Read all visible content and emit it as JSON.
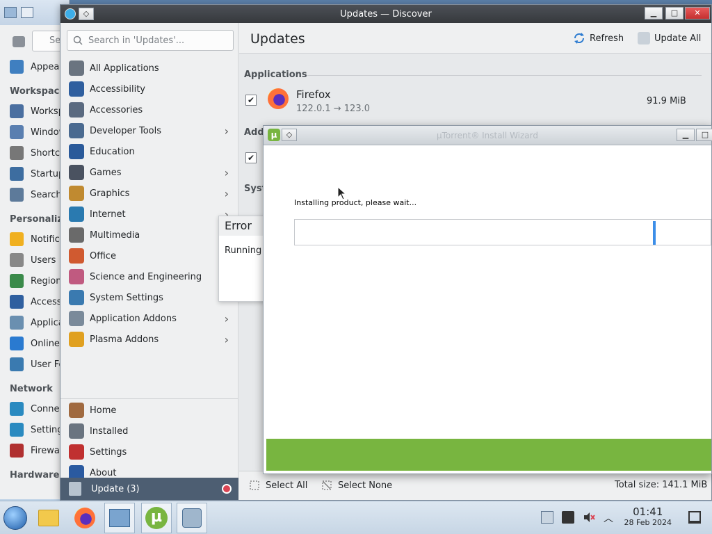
{
  "bg_window": {
    "search_placeholder": "Se",
    "items": [
      {
        "label": "Appea",
        "icon": "appearance-icon",
        "color": "#3f7fc0"
      },
      {
        "label": "Worksp",
        "icon": "workspace-icon",
        "color": "#4a6fa0"
      },
      {
        "label": "Window",
        "icon": "window-icon",
        "color": "#5a7fb0"
      },
      {
        "label": "Shortc",
        "icon": "keyboard-icon",
        "color": "#777777"
      },
      {
        "label": "Startup",
        "icon": "startup-icon",
        "color": "#3d6da0"
      },
      {
        "label": "Search",
        "icon": "search-icon",
        "color": "#5d7a9a"
      },
      {
        "label": "Notifica",
        "icon": "bell-icon",
        "color": "#f0b020"
      },
      {
        "label": "Users",
        "icon": "users-icon",
        "color": "#888888"
      },
      {
        "label": "Regiona",
        "icon": "globe-icon",
        "color": "#3a8a4a"
      },
      {
        "label": "Accessi",
        "icon": "accessibility-icon",
        "color": "#2f5f9f"
      },
      {
        "label": "Applica",
        "icon": "applications-icon",
        "color": "#6a8fb0"
      },
      {
        "label": "Online A",
        "icon": "online-accounts-icon",
        "color": "#2a7ad0"
      },
      {
        "label": "User Fe",
        "icon": "feedback-icon",
        "color": "#3a7ab0"
      },
      {
        "label": "Conne",
        "icon": "network-icon",
        "color": "#2a8ac0"
      },
      {
        "label": "Settings",
        "icon": "network-settings-icon",
        "color": "#2a8ac0"
      },
      {
        "label": "Firewal",
        "icon": "firewall-icon",
        "color": "#b03030"
      }
    ],
    "headings": [
      "Workspace",
      "Personaliza",
      "Network",
      "Hardware"
    ]
  },
  "discover": {
    "title": "Updates — Discover",
    "search_placeholder": "Search in 'Updates'...",
    "categories": [
      {
        "label": "All Applications",
        "icon": "grid-icon",
        "color": "#6a7480",
        "submenu": false
      },
      {
        "label": "Accessibility",
        "icon": "accessibility-icon",
        "color": "#2f5f9f",
        "submenu": false
      },
      {
        "label": "Accessories",
        "icon": "accessories-icon",
        "color": "#5a6a80",
        "submenu": false
      },
      {
        "label": "Developer Tools",
        "icon": "developer-tools-icon",
        "color": "#4a6a90",
        "submenu": true
      },
      {
        "label": "Education",
        "icon": "education-icon",
        "color": "#2a5a9a",
        "submenu": false
      },
      {
        "label": "Games",
        "icon": "games-icon",
        "color": "#4a5260",
        "submenu": true
      },
      {
        "label": "Graphics",
        "icon": "graphics-icon",
        "color": "#c08a30",
        "submenu": true
      },
      {
        "label": "Internet",
        "icon": "internet-icon",
        "color": "#2a7ab0",
        "submenu": true
      },
      {
        "label": "Multimedia",
        "icon": "multimedia-icon",
        "color": "#6a6a6a",
        "submenu": false
      },
      {
        "label": "Office",
        "icon": "office-icon",
        "color": "#d05a30",
        "submenu": false
      },
      {
        "label": "Science and Engineering",
        "icon": "science-icon",
        "color": "#c05a80",
        "submenu": false
      },
      {
        "label": "System Settings",
        "icon": "system-settings-icon",
        "color": "#3a7ab0",
        "submenu": false
      },
      {
        "label": "Application Addons",
        "icon": "application-addons-icon",
        "color": "#7a8a9a",
        "submenu": true
      },
      {
        "label": "Plasma Addons",
        "icon": "plasma-addons-icon",
        "color": "#e0a020",
        "submenu": true
      }
    ],
    "nav": [
      {
        "label": "Home",
        "icon": "home-icon",
        "color": "#a06a40"
      },
      {
        "label": "Installed",
        "icon": "installed-icon",
        "color": "#6a7480"
      },
      {
        "label": "Settings",
        "icon": "settings-icon",
        "color": "#c03030"
      },
      {
        "label": "About",
        "icon": "about-icon",
        "color": "#2a5aa0"
      }
    ],
    "update_bar_label": "Update (3)",
    "page_title": "Updates",
    "refresh_label": "Refresh",
    "update_all_label": "Update All",
    "section_applications": "Applications",
    "section_addons": "Addo",
    "section_system": "Syste",
    "firefox": {
      "name": "Firefox",
      "version": "122.0.1 → 123.0",
      "size": "91.9 MiB"
    },
    "select_all_label": "Select All",
    "select_none_label": "Select None",
    "total_size": "Total size: 141.1 MiB"
  },
  "error_popup": {
    "title": "Error",
    "message": "Running a"
  },
  "installer": {
    "title": "µTorrent® Install Wizard",
    "message": "Installing product, please wait...",
    "progress": 0.87
  },
  "taskbar": {
    "time": "01:41",
    "date": "28 Feb 2024"
  }
}
